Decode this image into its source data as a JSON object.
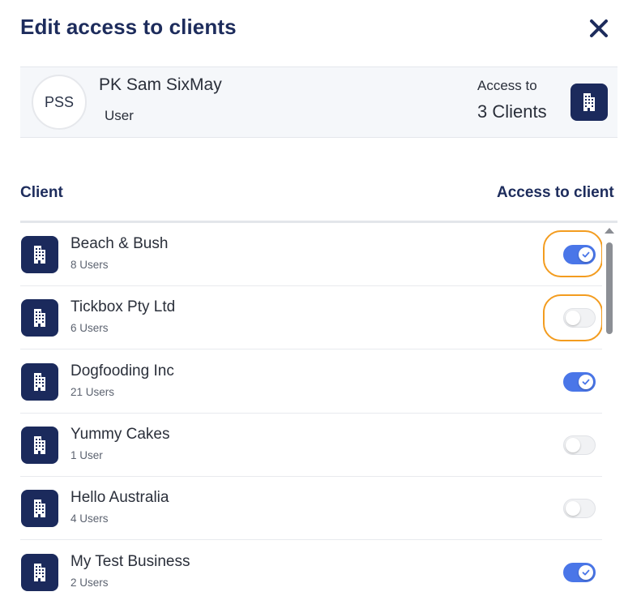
{
  "dialog": {
    "title": "Edit access to clients"
  },
  "user": {
    "initials": "PSS",
    "name": "PK Sam SixMay",
    "role": "User",
    "access_label": "Access to",
    "access_count": "3 Clients"
  },
  "columns": {
    "client": "Client",
    "access": "Access to client"
  },
  "clients": [
    {
      "name": "Beach & Bush",
      "users": "8 Users",
      "access": true,
      "highlighted": true
    },
    {
      "name": "Tickbox Pty Ltd",
      "users": "6 Users",
      "access": false,
      "highlighted": true
    },
    {
      "name": "Dogfooding Inc",
      "users": "21 Users",
      "access": true,
      "highlighted": false
    },
    {
      "name": "Yummy Cakes",
      "users": "1 User",
      "access": false,
      "highlighted": false
    },
    {
      "name": "Hello Australia",
      "users": "4 Users",
      "access": false,
      "highlighted": false
    },
    {
      "name": "My Test Business",
      "users": "2 Users",
      "access": true,
      "highlighted": false
    }
  ],
  "icons": {
    "close": "close-icon",
    "client": "building-icon",
    "toggle_check": "check-icon"
  },
  "colors": {
    "brand_navy": "#1b2a5c",
    "toggle_on": "#4a76e8",
    "highlight_ring": "#f39c1f"
  }
}
